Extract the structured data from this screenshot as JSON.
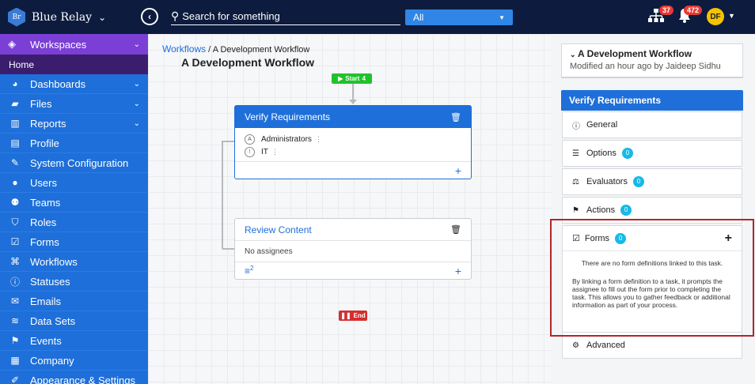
{
  "app": {
    "name": "Blue Relay",
    "logo_text": "Br"
  },
  "topbar": {
    "search_placeholder": "Search for something",
    "scope": "All",
    "org_badge": "37",
    "notif_badge": "472",
    "avatar_initials": "DF"
  },
  "sidebar": {
    "header": "Workspaces",
    "home": "Home",
    "items": [
      {
        "label": "Dashboards",
        "icon": "dashboard-icon",
        "has_chevron": true
      },
      {
        "label": "Files",
        "icon": "folder-icon",
        "has_chevron": true
      },
      {
        "label": "Reports",
        "icon": "bar-chart-icon",
        "has_chevron": true
      },
      {
        "label": "Profile",
        "icon": "id-card-icon"
      },
      {
        "label": "System Configuration",
        "icon": "wrench-icon"
      },
      {
        "label": "Users",
        "icon": "user-icon"
      },
      {
        "label": "Teams",
        "icon": "users-icon"
      },
      {
        "label": "Roles",
        "icon": "shield-icon"
      },
      {
        "label": "Forms",
        "icon": "checkbox-icon"
      },
      {
        "label": "Workflows",
        "icon": "sitemap-icon"
      },
      {
        "label": "Statuses",
        "icon": "info-icon"
      },
      {
        "label": "Emails",
        "icon": "envelope-icon"
      },
      {
        "label": "Data Sets",
        "icon": "database-icon"
      },
      {
        "label": "Events",
        "icon": "flag-icon"
      },
      {
        "label": "Company",
        "icon": "building-icon"
      },
      {
        "label": "Appearance & Settings",
        "icon": "paint-icon"
      }
    ]
  },
  "canvas": {
    "breadcrumb_root": "Workflows",
    "breadcrumb_sep": " / ",
    "breadcrumb_current": "A Development Workflow",
    "title": "A Development Workflow",
    "start_label": "Start",
    "start_count": "4",
    "end_label": "End",
    "tasks": [
      {
        "name": "Verify Requirements",
        "assignees": [
          {
            "initial": "A",
            "name": "Administrators"
          },
          {
            "initial": "!",
            "name": "IT"
          }
        ]
      },
      {
        "name": "Review Content",
        "empty_text": "No assignees",
        "list_count": "2"
      }
    ]
  },
  "right_panel": {
    "workflow_title": "A Development Workflow",
    "modified": "Modified an hour ago by Jaideep Sidhu",
    "task_title": "Verify Requirements",
    "sections": {
      "general": "General",
      "options": "Options",
      "options_count": "0",
      "evaluators": "Evaluators",
      "evaluators_count": "0",
      "actions": "Actions",
      "actions_count": "0",
      "forms": "Forms",
      "forms_count": "0",
      "advanced": "Advanced"
    },
    "forms_empty": "There are no form definitions linked to this task.",
    "forms_desc": "By linking a form definition to a task, it prompts the assignee to fill out the form prior to completing the task. This allows you to gather feedback or additional information as part of your process."
  }
}
